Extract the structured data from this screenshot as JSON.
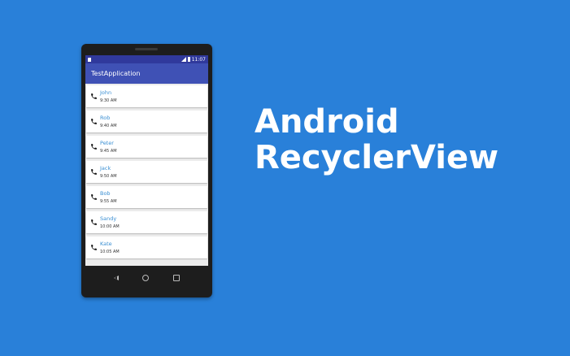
{
  "status_bar": {
    "time": "11:07"
  },
  "app_bar": {
    "title": "TestApplication"
  },
  "contacts": [
    {
      "name": "John",
      "time": "9:30 AM",
      "icon": "phone-icon"
    },
    {
      "name": "Rob",
      "time": "9:40 AM",
      "icon": "phone-icon"
    },
    {
      "name": "Peter",
      "time": "9:45 AM",
      "icon": "phone-icon"
    },
    {
      "name": "Jack",
      "time": "9:50 AM",
      "icon": "phone-icon"
    },
    {
      "name": "Bob",
      "time": "9:55 AM",
      "icon": "phone-icon"
    },
    {
      "name": "Sandy",
      "time": "10:00 AM",
      "icon": "phone-icon"
    },
    {
      "name": "Kate",
      "time": "10:05 AM",
      "icon": "phone-icon"
    }
  ],
  "headline": {
    "line1": "Android",
    "line2": "RecyclerView"
  },
  "colors": {
    "background": "#2980d9",
    "app_bar": "#3f51b5",
    "status_bar": "#30399c",
    "contact_name": "#3a8fd3"
  }
}
